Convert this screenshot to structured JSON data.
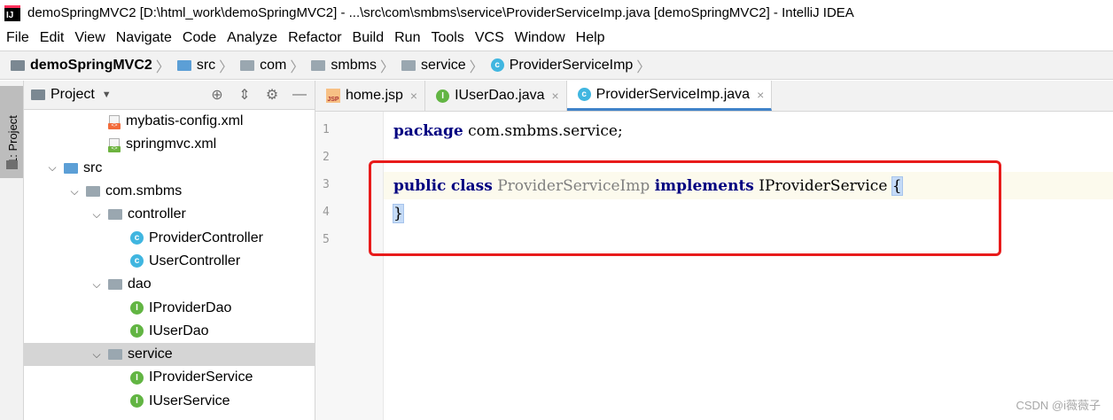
{
  "window": {
    "title": "demoSpringMVC2 [D:\\html_work\\demoSpringMVC2] - ...\\src\\com\\smbms\\service\\ProviderServiceImp.java [demoSpringMVC2] - IntelliJ IDEA",
    "logo_text": "IJ"
  },
  "menu": [
    "File",
    "Edit",
    "View",
    "Navigate",
    "Code",
    "Analyze",
    "Refactor",
    "Build",
    "Run",
    "Tools",
    "VCS",
    "Window",
    "Help"
  ],
  "breadcrumb": [
    {
      "label": "demoSpringMVC2",
      "icon": "module-folder-icon",
      "bold": true
    },
    {
      "label": "src",
      "icon": "source-folder-icon"
    },
    {
      "label": "com",
      "icon": "package-folder-icon"
    },
    {
      "label": "smbms",
      "icon": "package-folder-icon"
    },
    {
      "label": "service",
      "icon": "package-folder-icon"
    },
    {
      "label": "ProviderServiceImp",
      "icon": "class-icon"
    }
  ],
  "left_stripe": {
    "label": "1: Project"
  },
  "project_panel": {
    "title": "Project",
    "tools": [
      "locate-icon",
      "collapse-icon",
      "gear-icon",
      "hide-icon"
    ],
    "tree": [
      {
        "label": "mybatis-config.xml",
        "icon": "xml-file-icon",
        "depth": 3,
        "expandable": false
      },
      {
        "label": "springmvc.xml",
        "icon": "spring-xml-file-icon",
        "depth": 3,
        "expandable": false
      },
      {
        "label": "src",
        "icon": "source-folder-icon",
        "depth": 1,
        "expandable": true,
        "expanded": true
      },
      {
        "label": "com.smbms",
        "icon": "package-folder-icon",
        "depth": 2,
        "expandable": true,
        "expanded": true
      },
      {
        "label": "controller",
        "icon": "package-folder-icon",
        "depth": 3,
        "expandable": true,
        "expanded": true
      },
      {
        "label": "ProviderController",
        "icon": "class-icon",
        "depth": 4,
        "expandable": false
      },
      {
        "label": "UserController",
        "icon": "class-icon",
        "depth": 4,
        "expandable": false
      },
      {
        "label": "dao",
        "icon": "package-folder-icon",
        "depth": 3,
        "expandable": true,
        "expanded": true
      },
      {
        "label": "IProviderDao",
        "icon": "interface-icon",
        "depth": 4,
        "expandable": false
      },
      {
        "label": "IUserDao",
        "icon": "interface-icon",
        "depth": 4,
        "expandable": false
      },
      {
        "label": "service",
        "icon": "package-folder-icon",
        "depth": 3,
        "expandable": true,
        "expanded": true,
        "selected": true
      },
      {
        "label": "IProviderService",
        "icon": "interface-icon",
        "depth": 4,
        "expandable": false
      },
      {
        "label": "IUserService",
        "icon": "interface-icon",
        "depth": 4,
        "expandable": false
      }
    ]
  },
  "tabs": [
    {
      "label": "home.jsp",
      "icon": "jsp-file-icon",
      "active": false
    },
    {
      "label": "IUserDao.java",
      "icon": "interface-icon",
      "active": false
    },
    {
      "label": "ProviderServiceImp.java",
      "icon": "class-icon",
      "active": true
    }
  ],
  "editor": {
    "line_numbers": [
      "1",
      "2",
      "3",
      "4",
      "5"
    ],
    "lines": [
      [
        {
          "t": "package",
          "c": "kw"
        },
        {
          "t": " com.smbms.service;",
          "c": "pkg"
        }
      ],
      [],
      [
        {
          "t": "public",
          "c": "kw"
        },
        {
          "t": " ",
          "c": "pkg"
        },
        {
          "t": "class",
          "c": "kw"
        },
        {
          "t": " ",
          "c": "pkg"
        },
        {
          "t": "ProviderServiceImp",
          "c": "unused"
        },
        {
          "t": " ",
          "c": "pkg"
        },
        {
          "t": "implements",
          "c": "kw"
        },
        {
          "t": " IProviderService ",
          "c": "pkg"
        },
        {
          "t": "{",
          "c": "brace-hl"
        }
      ],
      [
        {
          "t": "}",
          "c": "brace-match"
        }
      ],
      []
    ],
    "current_line": 3
  },
  "watermark": "CSDN @i薇薇子",
  "colors": {
    "keyword": "#000080",
    "highlight_box": "#e81b1b",
    "selection": "#d5d5d5",
    "active_tab": "#4083c9"
  }
}
